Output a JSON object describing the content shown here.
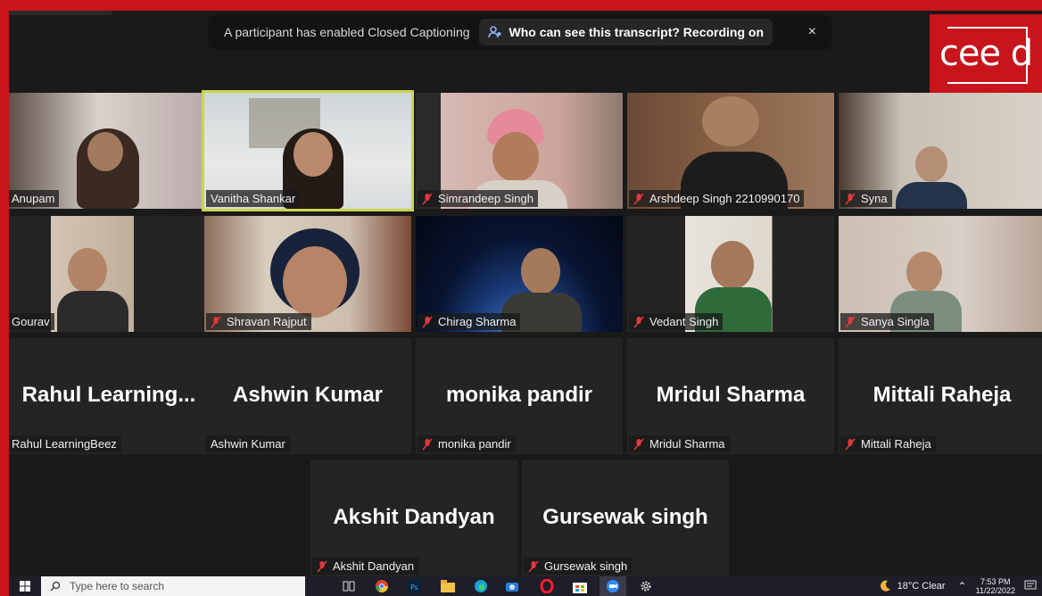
{
  "banner": {
    "message": "A participant has enabled Closed Captioning",
    "link": "Who can see this transcript? Recording on",
    "close": "×"
  },
  "logo": {
    "text": "cee d"
  },
  "row1": [
    {
      "name": "Anupam",
      "muted": false
    },
    {
      "name": "Vanitha Shankar",
      "muted": false,
      "active": true
    },
    {
      "name": "Simrandeep Singh",
      "muted": true
    },
    {
      "name": "Arshdeep Singh 2210990170",
      "muted": true
    },
    {
      "name": "Syna",
      "muted": true
    }
  ],
  "row2": [
    {
      "name": "Gourav",
      "muted": false
    },
    {
      "name": "Shravan Rajput",
      "muted": true
    },
    {
      "name": "Chirag Sharma",
      "muted": true
    },
    {
      "name": "Vedant Singh",
      "muted": true
    },
    {
      "name": "Sanya Singla",
      "muted": true
    }
  ],
  "row3": [
    {
      "display": "Rahul  Learning...",
      "name": "Rahul LearningBeez",
      "muted": false
    },
    {
      "display": "Ashwin Kumar",
      "name": "Ashwin Kumar",
      "muted": false
    },
    {
      "display": "monika pandir",
      "name": "monika pandir",
      "muted": true
    },
    {
      "display": "Mridul Sharma",
      "name": "Mridul Sharma",
      "muted": true
    },
    {
      "display": "Mittali Raheja",
      "name": "Mittali Raheja",
      "muted": true
    }
  ],
  "row4": [
    {
      "display": "Akshit Dandyan",
      "name": "Akshit Dandyan",
      "muted": true
    },
    {
      "display": "Gursewak singh",
      "name": "Gursewak singh",
      "muted": true
    }
  ],
  "taskbar": {
    "search_placeholder": "Type here to search",
    "weather": "18°C  Clear",
    "time": "7:53 PM",
    "date": "11/22/2022"
  },
  "colors": {
    "frame": "#c8141b",
    "active_outline": "#c9d64a",
    "muted_icon": "#e0393e"
  }
}
